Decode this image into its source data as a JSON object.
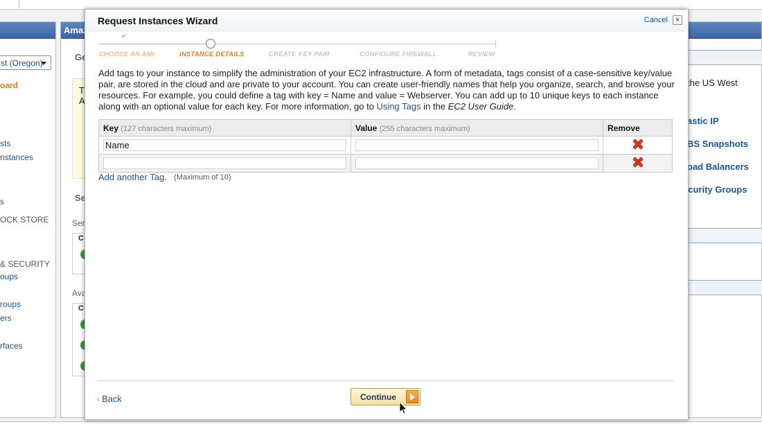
{
  "background": {
    "region_selector": "st (Oregon)",
    "sidebar_items": [
      {
        "label": "oard",
        "style": "orange"
      },
      {
        "label": "sts",
        "style": "link"
      },
      {
        "label": "nstances",
        "style": "link"
      },
      {
        "label": "s",
        "style": "link"
      },
      {
        "label": "OCK STORE",
        "style": "grey"
      },
      {
        "label": "& SECURITY",
        "style": "grey"
      },
      {
        "label": "oups",
        "style": "link"
      },
      {
        "label": "roups",
        "style": "link"
      },
      {
        "label": "ers",
        "style": "link"
      },
      {
        "label": "rfaces",
        "style": "link"
      }
    ],
    "main_panel_title": "Amaz",
    "fragments": {
      "getting_started": "Ge",
      "yellow_t": "T",
      "yellow_a": "A",
      "service_heading": "Se",
      "service_sub": "Ser",
      "avail": "Ava",
      "col_c1": "C",
      "col_c2": "C",
      "right_us_west": "the US West",
      "right_elastic_ip": "astic IP",
      "right_ebs_snapshots": "BS Snapshots",
      "right_load_balancers": "oad Balancers",
      "right_security_groups": "ecurity Groups"
    }
  },
  "wizard": {
    "title": "Request Instances Wizard",
    "cancel_label": "Cancel",
    "close_symbol": "×",
    "steps": [
      {
        "label": "CHOOSE AN AMI",
        "state": "done"
      },
      {
        "label": "INSTANCE DETAILS",
        "state": "current"
      },
      {
        "label": "CREATE KEY PAIR",
        "state": "todo"
      },
      {
        "label": "CONFIGURE FIREWALL",
        "state": "todo"
      },
      {
        "label": "REVIEW",
        "state": "todo"
      }
    ],
    "intro_text": "Add tags to your instance to simplify the administration of your EC2 infrastructure. A form of metadata, tags consist of a case-sensitive key/value pair, are stored in the cloud and are private to your account. You can create user-friendly names that help you organize, search, and browse your resources. For example, you could define a tag with key = Name and value = Webserver. You can add up to 10 unique keys to each instance along with an optional value for each key. For more information, go to ",
    "intro_link": "Using Tags",
    "intro_mid": " in the ",
    "intro_guide": "EC2 User Guide",
    "intro_end": ".",
    "table": {
      "key_header": "Key",
      "key_hint": "(127 characters maximum)",
      "value_header": "Value",
      "value_hint": "(255 characters maximum)",
      "remove_header": "Remove",
      "rows": [
        {
          "key": "Name",
          "value": ""
        },
        {
          "key": "",
          "value": ""
        }
      ]
    },
    "add_tag_label": "Add another Tag.",
    "add_tag_hint": "(Maximum of 10)",
    "back_label": "Back",
    "back_chevron": "‹",
    "continue_label": "Continue"
  }
}
